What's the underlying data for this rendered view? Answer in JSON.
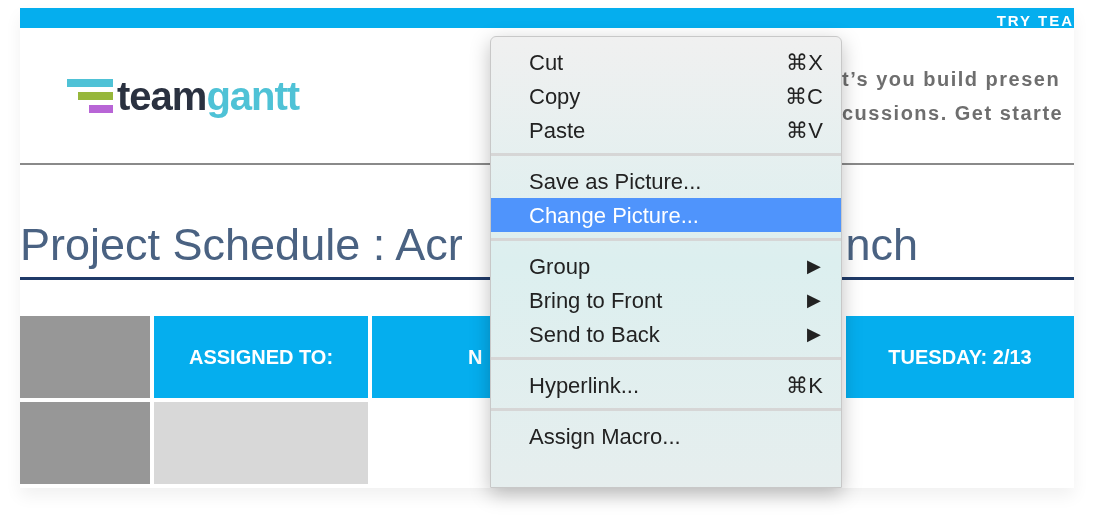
{
  "top_bar": {
    "cta": "TRY TEA"
  },
  "logo": {
    "part_1": "team",
    "part_2": "gantt"
  },
  "intro_lines": [
    "t’s you build presen",
    "cussions. Get starte"
  ],
  "title": {
    "left": "Project Schedule : Acr",
    "right": "nch"
  },
  "table": {
    "header": [
      {
        "kind": "blank"
      },
      {
        "kind": "label",
        "text": "ASSIGNED TO:"
      },
      {
        "kind": "label",
        "text": "N"
      },
      {
        "kind": "label",
        "text": "TUESDAY: 2/13"
      }
    ]
  },
  "menu": {
    "groups": [
      [
        {
          "label": "Cut",
          "shortcut": "⌘X",
          "selected": false
        },
        {
          "label": "Copy",
          "shortcut": "⌘C",
          "selected": false
        },
        {
          "label": "Paste",
          "shortcut": "⌘V",
          "selected": false
        }
      ],
      [
        {
          "label": "Save as Picture...",
          "selected": false
        },
        {
          "label": "Change Picture...",
          "selected": true
        }
      ],
      [
        {
          "label": "Group",
          "submenu": "▶",
          "selected": false
        },
        {
          "label": "Bring to Front",
          "submenu": "▶",
          "selected": false
        },
        {
          "label": "Send to Back",
          "submenu": "▶",
          "selected": false
        }
      ],
      [
        {
          "label": "Hyperlink...",
          "shortcut": "⌘K",
          "selected": false
        }
      ],
      [
        {
          "label": "Assign Macro...",
          "selected": false
        }
      ]
    ]
  }
}
